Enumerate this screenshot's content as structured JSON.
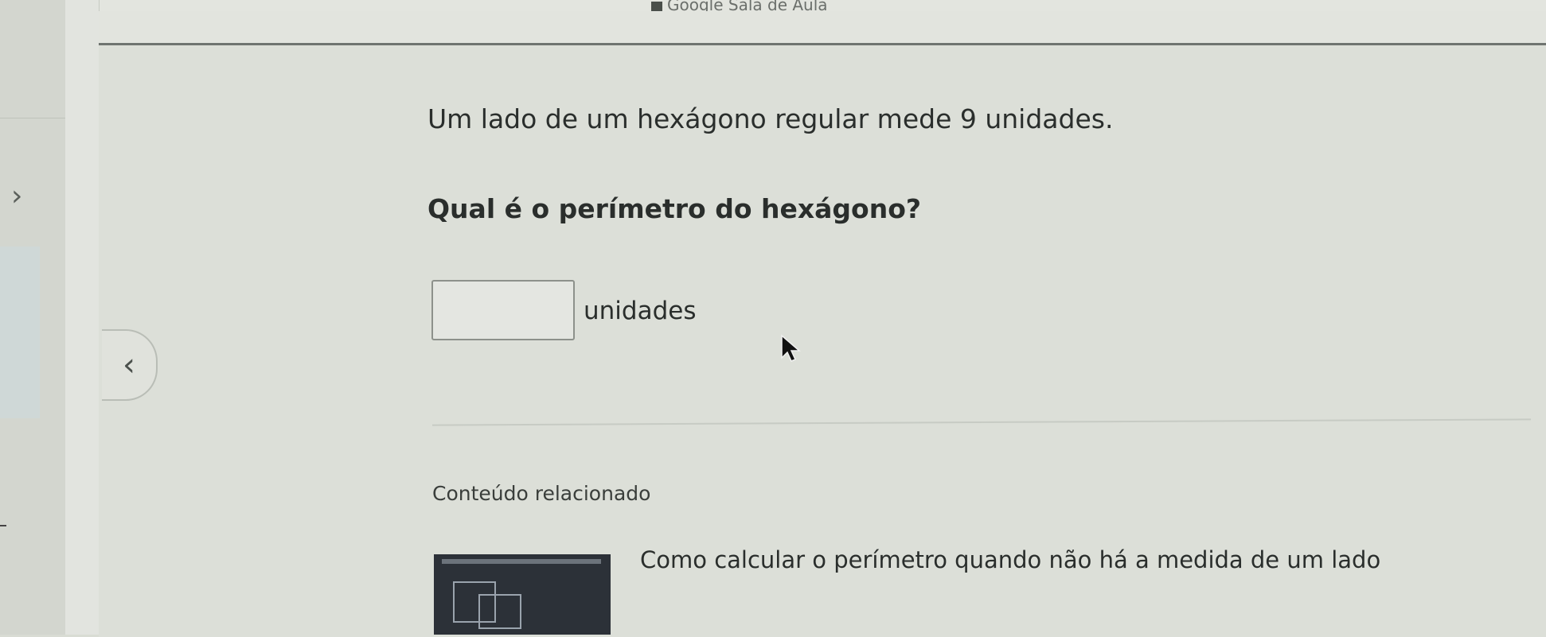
{
  "window": {
    "title": "Google Sala de Aula"
  },
  "question": {
    "statement": "Um lado de um hexágono regular mede 9 unidades.",
    "prompt": "Qual é o perímetro do hexágono?",
    "answer_value": "",
    "unit_label": "unidades"
  },
  "navigation": {
    "back_icon": "chevron-left-icon",
    "sidebar_icon": "chevron-right-icon"
  },
  "related": {
    "heading": "Conteúdo relacionado",
    "items": [
      {
        "title": "Como calcular o perímetro quando não há a medida de um lado"
      }
    ]
  }
}
